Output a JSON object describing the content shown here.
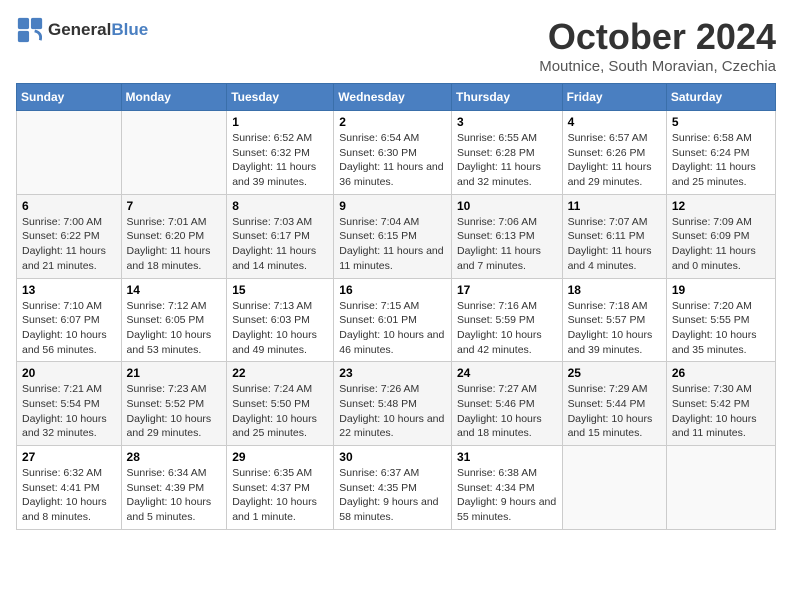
{
  "header": {
    "logo_general": "General",
    "logo_blue": "Blue",
    "month": "October 2024",
    "location": "Moutnice, South Moravian, Czechia"
  },
  "days_of_week": [
    "Sunday",
    "Monday",
    "Tuesday",
    "Wednesday",
    "Thursday",
    "Friday",
    "Saturday"
  ],
  "weeks": [
    [
      {
        "day": "",
        "sunrise": "",
        "sunset": "",
        "daylight": ""
      },
      {
        "day": "",
        "sunrise": "",
        "sunset": "",
        "daylight": ""
      },
      {
        "day": "1",
        "sunrise": "Sunrise: 6:52 AM",
        "sunset": "Sunset: 6:32 PM",
        "daylight": "Daylight: 11 hours and 39 minutes."
      },
      {
        "day": "2",
        "sunrise": "Sunrise: 6:54 AM",
        "sunset": "Sunset: 6:30 PM",
        "daylight": "Daylight: 11 hours and 36 minutes."
      },
      {
        "day": "3",
        "sunrise": "Sunrise: 6:55 AM",
        "sunset": "Sunset: 6:28 PM",
        "daylight": "Daylight: 11 hours and 32 minutes."
      },
      {
        "day": "4",
        "sunrise": "Sunrise: 6:57 AM",
        "sunset": "Sunset: 6:26 PM",
        "daylight": "Daylight: 11 hours and 29 minutes."
      },
      {
        "day": "5",
        "sunrise": "Sunrise: 6:58 AM",
        "sunset": "Sunset: 6:24 PM",
        "daylight": "Daylight: 11 hours and 25 minutes."
      }
    ],
    [
      {
        "day": "6",
        "sunrise": "Sunrise: 7:00 AM",
        "sunset": "Sunset: 6:22 PM",
        "daylight": "Daylight: 11 hours and 21 minutes."
      },
      {
        "day": "7",
        "sunrise": "Sunrise: 7:01 AM",
        "sunset": "Sunset: 6:20 PM",
        "daylight": "Daylight: 11 hours and 18 minutes."
      },
      {
        "day": "8",
        "sunrise": "Sunrise: 7:03 AM",
        "sunset": "Sunset: 6:17 PM",
        "daylight": "Daylight: 11 hours and 14 minutes."
      },
      {
        "day": "9",
        "sunrise": "Sunrise: 7:04 AM",
        "sunset": "Sunset: 6:15 PM",
        "daylight": "Daylight: 11 hours and 11 minutes."
      },
      {
        "day": "10",
        "sunrise": "Sunrise: 7:06 AM",
        "sunset": "Sunset: 6:13 PM",
        "daylight": "Daylight: 11 hours and 7 minutes."
      },
      {
        "day": "11",
        "sunrise": "Sunrise: 7:07 AM",
        "sunset": "Sunset: 6:11 PM",
        "daylight": "Daylight: 11 hours and 4 minutes."
      },
      {
        "day": "12",
        "sunrise": "Sunrise: 7:09 AM",
        "sunset": "Sunset: 6:09 PM",
        "daylight": "Daylight: 11 hours and 0 minutes."
      }
    ],
    [
      {
        "day": "13",
        "sunrise": "Sunrise: 7:10 AM",
        "sunset": "Sunset: 6:07 PM",
        "daylight": "Daylight: 10 hours and 56 minutes."
      },
      {
        "day": "14",
        "sunrise": "Sunrise: 7:12 AM",
        "sunset": "Sunset: 6:05 PM",
        "daylight": "Daylight: 10 hours and 53 minutes."
      },
      {
        "day": "15",
        "sunrise": "Sunrise: 7:13 AM",
        "sunset": "Sunset: 6:03 PM",
        "daylight": "Daylight: 10 hours and 49 minutes."
      },
      {
        "day": "16",
        "sunrise": "Sunrise: 7:15 AM",
        "sunset": "Sunset: 6:01 PM",
        "daylight": "Daylight: 10 hours and 46 minutes."
      },
      {
        "day": "17",
        "sunrise": "Sunrise: 7:16 AM",
        "sunset": "Sunset: 5:59 PM",
        "daylight": "Daylight: 10 hours and 42 minutes."
      },
      {
        "day": "18",
        "sunrise": "Sunrise: 7:18 AM",
        "sunset": "Sunset: 5:57 PM",
        "daylight": "Daylight: 10 hours and 39 minutes."
      },
      {
        "day": "19",
        "sunrise": "Sunrise: 7:20 AM",
        "sunset": "Sunset: 5:55 PM",
        "daylight": "Daylight: 10 hours and 35 minutes."
      }
    ],
    [
      {
        "day": "20",
        "sunrise": "Sunrise: 7:21 AM",
        "sunset": "Sunset: 5:54 PM",
        "daylight": "Daylight: 10 hours and 32 minutes."
      },
      {
        "day": "21",
        "sunrise": "Sunrise: 7:23 AM",
        "sunset": "Sunset: 5:52 PM",
        "daylight": "Daylight: 10 hours and 29 minutes."
      },
      {
        "day": "22",
        "sunrise": "Sunrise: 7:24 AM",
        "sunset": "Sunset: 5:50 PM",
        "daylight": "Daylight: 10 hours and 25 minutes."
      },
      {
        "day": "23",
        "sunrise": "Sunrise: 7:26 AM",
        "sunset": "Sunset: 5:48 PM",
        "daylight": "Daylight: 10 hours and 22 minutes."
      },
      {
        "day": "24",
        "sunrise": "Sunrise: 7:27 AM",
        "sunset": "Sunset: 5:46 PM",
        "daylight": "Daylight: 10 hours and 18 minutes."
      },
      {
        "day": "25",
        "sunrise": "Sunrise: 7:29 AM",
        "sunset": "Sunset: 5:44 PM",
        "daylight": "Daylight: 10 hours and 15 minutes."
      },
      {
        "day": "26",
        "sunrise": "Sunrise: 7:30 AM",
        "sunset": "Sunset: 5:42 PM",
        "daylight": "Daylight: 10 hours and 11 minutes."
      }
    ],
    [
      {
        "day": "27",
        "sunrise": "Sunrise: 6:32 AM",
        "sunset": "Sunset: 4:41 PM",
        "daylight": "Daylight: 10 hours and 8 minutes."
      },
      {
        "day": "28",
        "sunrise": "Sunrise: 6:34 AM",
        "sunset": "Sunset: 4:39 PM",
        "daylight": "Daylight: 10 hours and 5 minutes."
      },
      {
        "day": "29",
        "sunrise": "Sunrise: 6:35 AM",
        "sunset": "Sunset: 4:37 PM",
        "daylight": "Daylight: 10 hours and 1 minute."
      },
      {
        "day": "30",
        "sunrise": "Sunrise: 6:37 AM",
        "sunset": "Sunset: 4:35 PM",
        "daylight": "Daylight: 9 hours and 58 minutes."
      },
      {
        "day": "31",
        "sunrise": "Sunrise: 6:38 AM",
        "sunset": "Sunset: 4:34 PM",
        "daylight": "Daylight: 9 hours and 55 minutes."
      },
      {
        "day": "",
        "sunrise": "",
        "sunset": "",
        "daylight": ""
      },
      {
        "day": "",
        "sunrise": "",
        "sunset": "",
        "daylight": ""
      }
    ]
  ]
}
